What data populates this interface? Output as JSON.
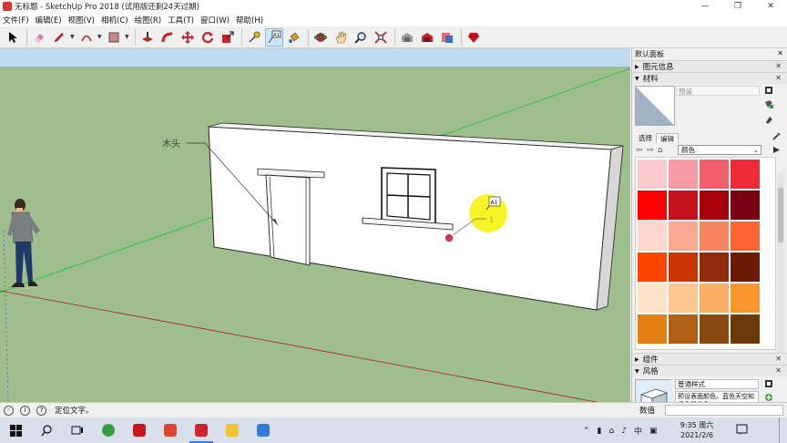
{
  "window": {
    "title": "无标题 - SketchUp Pro 2018  (试用版还剩24天过期)",
    "controls": [
      "—",
      "❐",
      "✕"
    ]
  },
  "menu": [
    "文件(F)",
    "编辑(E)",
    "视图(V)",
    "相机(C)",
    "绘图(R)",
    "工具(T)",
    "窗口(W)",
    "帮助(H)"
  ],
  "toolbar": {
    "tools": [
      "select-icon",
      "eraser-icon",
      "pencil-icon",
      "arc-icon",
      "rectangle-icon",
      "push-pull-icon",
      "follow-me-icon",
      "move-icon",
      "rotate-icon",
      "scale-icon",
      "tape-measure-icon",
      "text-icon",
      "paint-bucket-icon",
      "orbit-icon",
      "pan-icon",
      "zoom-icon",
      "zoom-extents-icon",
      "warehouse-icon",
      "extension-warehouse-icon",
      "send-to-layout-icon",
      "ruby-icon"
    ],
    "active_tool": "text-icon",
    "text_tool_glyph": "A1"
  },
  "viewport": {
    "label_text": "木头",
    "leader_cursor_text": "1",
    "cursor_badge": "A1",
    "colors": {
      "ground": "#9ebe8d",
      "sky": "#bfdcf2",
      "wall": "#ffffff",
      "highlight": "#f5f200"
    }
  },
  "tray": {
    "title": "默认面板",
    "close": "✕",
    "sections": {
      "entity_info": "图元信息",
      "materials": "材料",
      "components": "组件",
      "styles": "风格"
    },
    "materials": {
      "name_placeholder": "预设",
      "tabs": [
        "选择",
        "编辑"
      ],
      "library": "颜色",
      "swatches": [
        "#fdcbcd",
        "#f69ba1",
        "#f25e6a",
        "#f12a39",
        "#ff0000",
        "#c7121d",
        "#a8000a",
        "#780010",
        "#fcd8cc",
        "#f9a890",
        "#f8835f",
        "#fc6433",
        "#fe4500",
        "#c83500",
        "#922b0b",
        "#6c1a04",
        "#fde3c7",
        "#fcc690",
        "#f9ae63",
        "#fb972f",
        "#e28016",
        "#b06014",
        "#8a4a0f",
        "#6b3a08"
      ]
    },
    "styles": {
      "name": "普通样式",
      "description": "预设表面颜色。蓝色天空和绿色背景色。"
    }
  },
  "status": {
    "text": "定位文字。",
    "measurements_label": "数值",
    "icons": [
      "geo-icon",
      "info-icon",
      "help-icon"
    ]
  },
  "taskbar": {
    "clock_time": "9:35 周六",
    "clock_date": "2021/2/6",
    "ime": "中"
  }
}
